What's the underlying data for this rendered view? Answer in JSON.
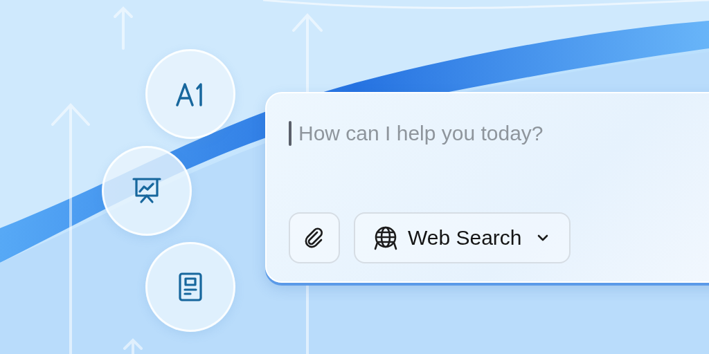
{
  "prompt": {
    "placeholder": "How can I help you today?"
  },
  "tools": [
    {
      "kind": "attach"
    },
    {
      "kind": "web_search",
      "label": "Web Search"
    }
  ],
  "shortcuts": [
    {
      "kind": "text"
    },
    {
      "kind": "presentation"
    },
    {
      "kind": "document"
    }
  ]
}
